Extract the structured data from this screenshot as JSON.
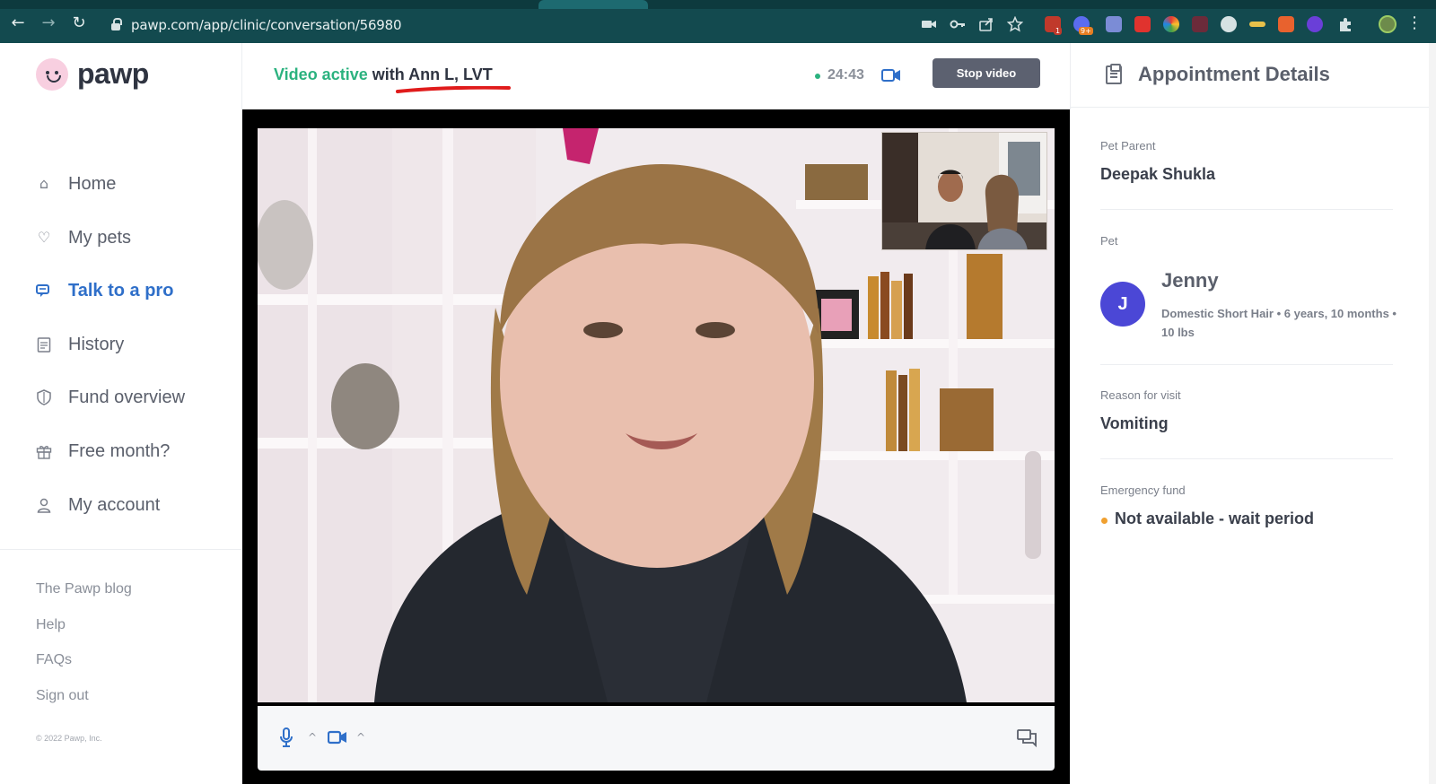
{
  "browser": {
    "url": "pawp.com/app/clinic/conversation/56980",
    "extension_badges": [
      "1",
      "9+"
    ],
    "accent": "#134a4f"
  },
  "sidebar": {
    "logo_text": "pawp",
    "nav": [
      {
        "label": "Home",
        "icon": "home-icon"
      },
      {
        "label": "My pets",
        "icon": "heart-icon"
      },
      {
        "label": "Talk to a pro",
        "icon": "chat-icon",
        "active": true
      },
      {
        "label": "History",
        "icon": "clipboard-icon"
      },
      {
        "label": "Fund overview",
        "icon": "shield-icon"
      },
      {
        "label": "Free month?",
        "icon": "gift-icon"
      },
      {
        "label": "My account",
        "icon": "user-icon"
      }
    ],
    "footer_links": [
      "The Pawp blog",
      "Help",
      "FAQs",
      "Sign out"
    ],
    "copyright": "© 2022 Pawp, Inc.",
    "active_color": "#2f6fc9"
  },
  "call": {
    "status": "Video active",
    "with_text": "with Ann L, LVT",
    "timer": "24:43",
    "stop_label": "Stop video",
    "status_color": "#2bb27f"
  },
  "details": {
    "title": "Appointment Details",
    "pet_parent_label": "Pet Parent",
    "pet_parent": "Deepak Shukla",
    "pet_label": "Pet",
    "pet_initial": "J",
    "pet_name": "Jenny",
    "pet_description": "Domestic Short Hair • 6 years, 10 months • 10 lbs",
    "reason_label": "Reason for visit",
    "reason": "Vomiting",
    "fund_label": "Emergency fund",
    "fund_status": "Not available - wait period"
  }
}
